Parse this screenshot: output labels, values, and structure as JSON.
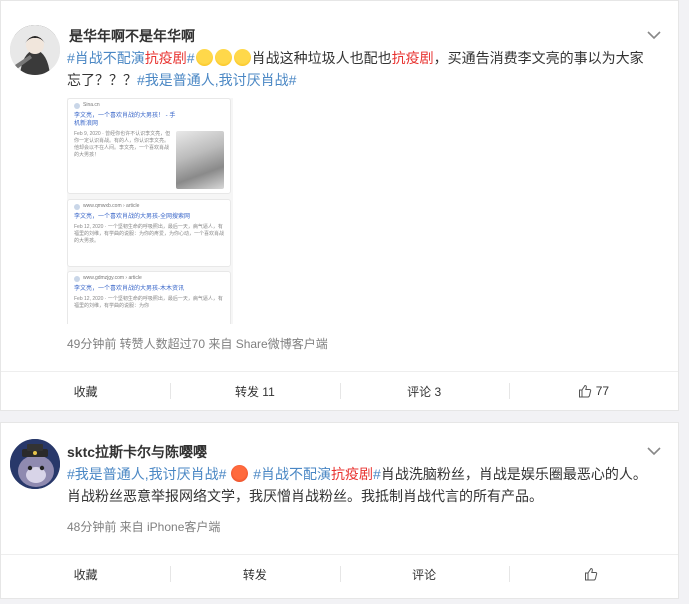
{
  "posts": [
    {
      "username": "是华年啊不是年华啊",
      "content": {
        "tag1_a": "#肖战不配演",
        "tag1_b": "抗疫剧",
        "tag1_c": "#",
        "text1": "肖战这种垃圾人也配也",
        "text1_red": "抗疫剧",
        "text2": "，买通告消费李文亮的事以为大家忘了？？？",
        "tag2": "#我是普通人,我讨厌肖战#"
      },
      "screenshot": {
        "results": [
          {
            "source": "Sina.cn",
            "title": "李文亮，一个喜欢肖战的大男孩！ - 手机新浪网",
            "date": "Feb 9, 2020",
            "snippet": "曾经你也许不认识李文亮，但你一定认识肖战。有的人，你认识李文亮。他却会以不在人间。李文亮，一个喜欢肖战的大男孩！"
          },
          {
            "source": "www.qmwxb.com › article",
            "title": "李文亮，一个喜欢肖战的大男孩-全网搜索网",
            "date": "Feb 12, 2020",
            "snippet": "一个坚韧生命的呼吸照出，最后一天，病气逼人，有福里的刘维，有学曲的说服：为你的疼爱，为你心动，一个喜欢肖战的大男孩。"
          },
          {
            "source": "www.gdmzjgy.com › article",
            "title": "李文亮，一个喜欢肖战的大男孩-木木资讯",
            "date": "Feb 12, 2020",
            "snippet": "一个坚韧生命的呼吸照出，最后一天，病气逼人，有福里的刘维，有学曲的说服：为你"
          }
        ]
      },
      "meta": "49分钟前 转赞人数超过70 来自 Share微博客户端",
      "actions": {
        "favorite": "收藏",
        "repost": "转发 11",
        "comment": "评论 3",
        "like_count": "77"
      }
    },
    {
      "username": "sktc拉斯卡尔与陈嘤嘤",
      "content": {
        "tag1": "#我是普通人,我讨厌肖战#",
        "tag2_a": "#肖战不配演",
        "tag2_b": "抗疫剧",
        "tag2_c": "#",
        "text": "肖战洗脑粉丝，肖战是娱乐圈最恶心的人。肖战粉丝恶意举报网络文学，我厌憎肖战粉丝。我抵制肖战代言的所有产品。"
      },
      "meta": "48分钟前 来自 iPhone客户端",
      "actions": {
        "favorite": "收藏",
        "repost": "转发",
        "comment": "评论",
        "like_count": ""
      }
    }
  ],
  "icons": {
    "chevron": "chevron-down-icon",
    "like": "thumbs-up-icon",
    "emoji_sad": "crying-face-icon",
    "emoji_angry": "angry-face-icon"
  },
  "colors": {
    "hashtag_blue": "#4a87c4",
    "hashtag_red": "#e8322f"
  }
}
